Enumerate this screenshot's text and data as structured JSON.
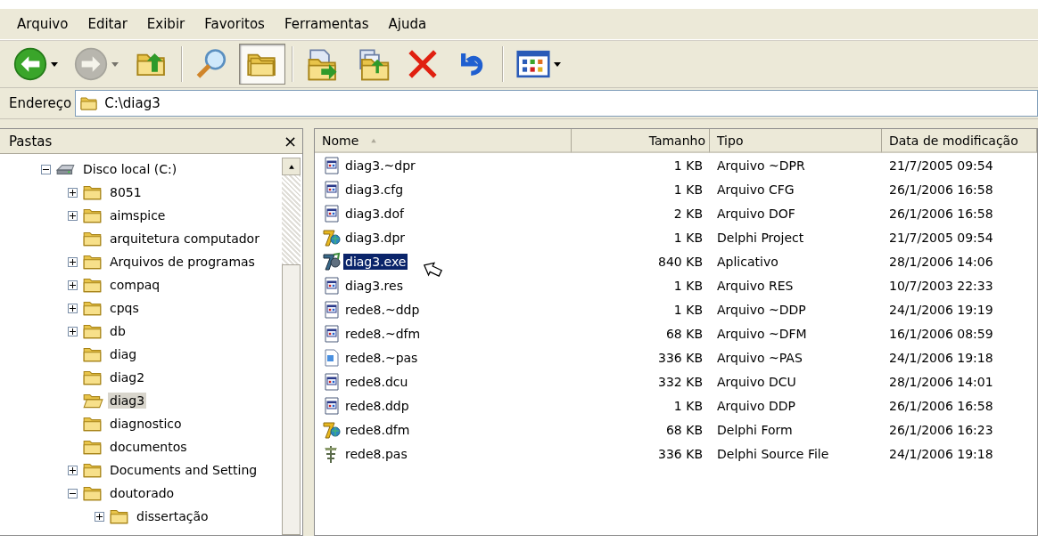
{
  "menu": [
    "Arquivo",
    "Editar",
    "Exibir",
    "Favoritos",
    "Ferramentas",
    "Ajuda"
  ],
  "toolbar": [
    {
      "kind": "back",
      "pressed": false,
      "disabled": false,
      "dropdown": true
    },
    {
      "kind": "forward",
      "pressed": false,
      "disabled": true,
      "dropdown": true
    },
    {
      "kind": "up",
      "pressed": false,
      "disabled": false,
      "dropdown": false
    },
    {
      "kind": "separator"
    },
    {
      "kind": "search",
      "pressed": false,
      "disabled": false,
      "dropdown": false
    },
    {
      "kind": "folders",
      "pressed": true,
      "disabled": false,
      "dropdown": false
    },
    {
      "kind": "separator"
    },
    {
      "kind": "move",
      "pressed": false,
      "disabled": false,
      "dropdown": false
    },
    {
      "kind": "copy",
      "pressed": false,
      "disabled": false,
      "dropdown": false
    },
    {
      "kind": "delete",
      "pressed": false,
      "disabled": false,
      "dropdown": false
    },
    {
      "kind": "undo",
      "pressed": false,
      "disabled": false,
      "dropdown": false
    },
    {
      "kind": "separator"
    },
    {
      "kind": "views",
      "pressed": false,
      "disabled": false,
      "dropdown": true
    }
  ],
  "address": {
    "label": "Endereço",
    "value": "C:\\diag3"
  },
  "folders": {
    "title": "Pastas",
    "close": "×",
    "tree": [
      {
        "label": "Disco local (C:)",
        "kind": "drive",
        "expandable": true,
        "expanded": true,
        "selected": false,
        "children": [
          {
            "label": "8051",
            "kind": "folder",
            "expandable": true,
            "expanded": false,
            "selected": false
          },
          {
            "label": "aimspice",
            "kind": "folder",
            "expandable": true,
            "expanded": false,
            "selected": false
          },
          {
            "label": "arquitetura computador",
            "kind": "folder",
            "expandable": false,
            "selected": false
          },
          {
            "label": "Arquivos de programas",
            "kind": "folder",
            "expandable": true,
            "expanded": false,
            "selected": false
          },
          {
            "label": "compaq",
            "kind": "folder",
            "expandable": true,
            "expanded": false,
            "selected": false
          },
          {
            "label": "cpqs",
            "kind": "folder",
            "expandable": true,
            "expanded": false,
            "selected": false
          },
          {
            "label": "db",
            "kind": "folder",
            "expandable": true,
            "expanded": false,
            "selected": false
          },
          {
            "label": "diag",
            "kind": "folder",
            "expandable": false,
            "selected": false
          },
          {
            "label": "diag2",
            "kind": "folder",
            "expandable": false,
            "selected": false
          },
          {
            "label": "diag3",
            "kind": "open-folder",
            "expandable": false,
            "selected": true
          },
          {
            "label": "diagnostico",
            "kind": "folder",
            "expandable": false,
            "selected": false
          },
          {
            "label": "documentos",
            "kind": "folder",
            "expandable": false,
            "selected": false
          },
          {
            "label": "Documents and Setting",
            "kind": "folder",
            "expandable": true,
            "expanded": false,
            "selected": false
          },
          {
            "label": "doutorado",
            "kind": "folder",
            "expandable": true,
            "expanded": true,
            "selected": false,
            "children": [
              {
                "label": "dissertação",
                "kind": "folder",
                "expandable": true,
                "expanded": false,
                "selected": false
              }
            ]
          }
        ]
      }
    ]
  },
  "files": {
    "columns": [
      {
        "label": "Nome",
        "kind": "name",
        "sorted": true
      },
      {
        "label": "Tamanho",
        "kind": "size",
        "sorted": false
      },
      {
        "label": "Tipo",
        "kind": "type",
        "sorted": false
      },
      {
        "label": "Data de modificação",
        "kind": "date",
        "sorted": false
      }
    ],
    "rows": [
      {
        "kind": "document",
        "name": "diag3.~dpr",
        "size": "1 KB",
        "type": "Arquivo ~DPR",
        "date": "21/7/2005 09:54",
        "selected": false
      },
      {
        "kind": "document",
        "name": "diag3.cfg",
        "size": "1 KB",
        "type": "Arquivo CFG",
        "date": "26/1/2006 16:58",
        "selected": false
      },
      {
        "kind": "document",
        "name": "diag3.dof",
        "size": "2 KB",
        "type": "Arquivo DOF",
        "date": "26/1/2006 16:58",
        "selected": false
      },
      {
        "kind": "delphi",
        "name": "diag3.dpr",
        "size": "1 KB",
        "type": "Delphi Project",
        "date": "21/7/2005 09:54",
        "selected": false
      },
      {
        "kind": "app",
        "name": "diag3.exe",
        "size": "840 KB",
        "type": "Aplicativo",
        "date": "28/1/2006 14:06",
        "selected": true
      },
      {
        "kind": "document",
        "name": "diag3.res",
        "size": "1 KB",
        "type": "Arquivo RES",
        "date": "10/7/2003 22:33",
        "selected": false
      },
      {
        "kind": "document",
        "name": "rede8.~ddp",
        "size": "1 KB",
        "type": "Arquivo ~DDP",
        "date": "24/1/2006 19:19",
        "selected": false
      },
      {
        "kind": "document",
        "name": "rede8.~dfm",
        "size": "68 KB",
        "type": "Arquivo ~DFM",
        "date": "16/1/2006 08:59",
        "selected": false
      },
      {
        "kind": "page",
        "name": "rede8.~pas",
        "size": "336 KB",
        "type": "Arquivo ~PAS",
        "date": "24/1/2006 19:18",
        "selected": false
      },
      {
        "kind": "document",
        "name": "rede8.dcu",
        "size": "332 KB",
        "type": "Arquivo DCU",
        "date": "28/1/2006 14:01",
        "selected": false
      },
      {
        "kind": "document",
        "name": "rede8.ddp",
        "size": "1 KB",
        "type": "Arquivo DDP",
        "date": "26/1/2006 16:58",
        "selected": false
      },
      {
        "kind": "delphi",
        "name": "rede8.dfm",
        "size": "68 KB",
        "type": "Delphi Form",
        "date": "26/1/2006 16:23",
        "selected": false
      },
      {
        "kind": "source",
        "name": "rede8.pas",
        "size": "336 KB",
        "type": "Delphi Source File",
        "date": "24/1/2006 19:18",
        "selected": false
      }
    ]
  }
}
